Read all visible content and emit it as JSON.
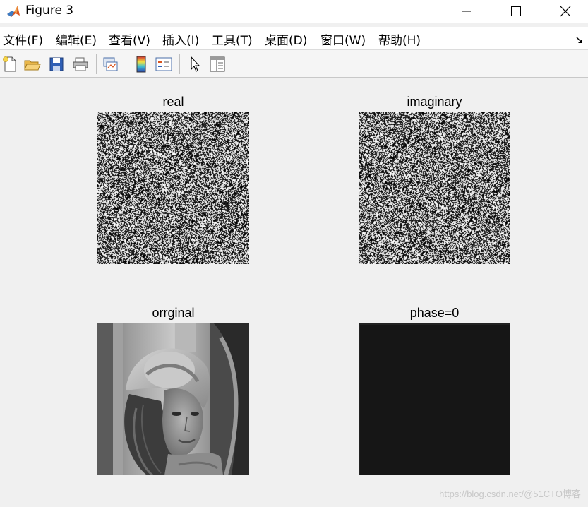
{
  "window": {
    "title": "Figure 3",
    "app_icon": "matlab-icon",
    "controls": [
      "minimize-icon",
      "maximize-icon",
      "close-icon"
    ]
  },
  "menu": {
    "items": [
      "文件(F)",
      "编辑(E)",
      "查看(V)",
      "插入(I)",
      "工具(T)",
      "桌面(D)",
      "窗口(W)",
      "帮助(H)"
    ],
    "dock_arrow_icon": "dock-arrow-icon"
  },
  "toolbar": {
    "icons": [
      "new-figure-icon",
      "open-file-icon",
      "save-icon",
      "print-icon",
      "link-plot-icon",
      "colorbar-icon",
      "legend-icon",
      "pointer-icon",
      "property-editor-icon"
    ]
  },
  "subplots": {
    "top_left": {
      "title": "real",
      "content": "noise"
    },
    "top_right": {
      "title": "imaginary",
      "content": "noise"
    },
    "bottom_left": {
      "title": "orrginal",
      "content": "grayscale photo"
    },
    "bottom_right": {
      "title": "phase=0",
      "content": "near-black"
    }
  },
  "colors": {
    "figure_bg": "#f0f0f0",
    "titlebar_bg": "#ffffff",
    "phase_image": "#161616"
  },
  "watermark": "https://blog.csdn.net/@51CTO博客"
}
